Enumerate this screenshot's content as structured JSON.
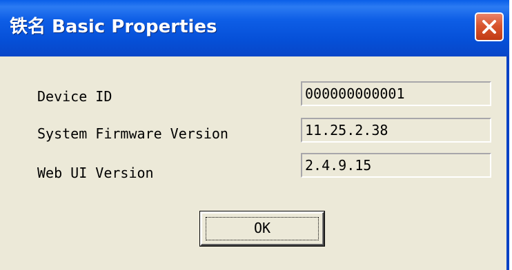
{
  "window": {
    "title": "铁名 Basic Properties",
    "close_icon": "close-icon"
  },
  "properties": [
    {
      "label": "Device ID",
      "value": "000000000001"
    },
    {
      "label": "System Firmware Version",
      "value": "11.25.2.38"
    },
    {
      "label": "Web UI Version",
      "value": "2.4.9.15"
    }
  ],
  "buttons": {
    "ok_label": "OK"
  },
  "colors": {
    "titlebar": "#0650d8",
    "dialog_background": "#ece9d8",
    "close_button": "#d9552e"
  }
}
